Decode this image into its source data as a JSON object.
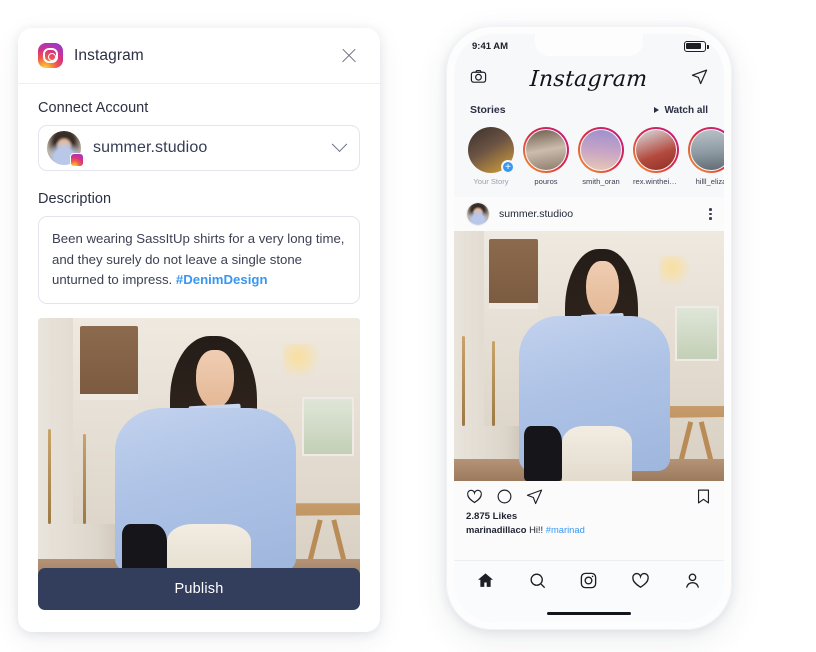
{
  "card": {
    "title": "Instagram",
    "icons": {
      "brand": "instagram-icon",
      "close": "close-icon"
    },
    "connect_label": "Connect Account",
    "account": {
      "username": "summer.studioo",
      "badge": "instagram-badge-icon",
      "chevron": "chevron-down-icon"
    },
    "description_label": "Description",
    "description": {
      "text": "Been wearing SassItUp shirts for a very long time, and they surely do not leave a single stone unturned to impress. ",
      "hashtag": "#DenimDesign"
    },
    "publish_label": "Publish"
  },
  "phone": {
    "status": {
      "time": "9:41 AM",
      "battery": "battery-icon"
    },
    "topbar": {
      "camera": "camera-icon",
      "logo": "Instagram",
      "send": "send-icon"
    },
    "stories_header": {
      "title": "Stories",
      "watch_all": "Watch all"
    },
    "stories": [
      {
        "name": "Your Story",
        "self": true
      },
      {
        "name": "pouros",
        "self": false
      },
      {
        "name": "smith_oran",
        "self": false
      },
      {
        "name": "rex.wintheiser",
        "self": false
      },
      {
        "name": "hilll_eliza",
        "self": false
      }
    ],
    "post": {
      "username": "summer.studioo",
      "menu": "more-options-icon",
      "actions": [
        "like-icon",
        "comment-icon",
        "share-icon",
        "bookmark-icon"
      ],
      "likes": "2.875 Likes",
      "comment_user": "marinadillaco",
      "comment_text": "Hi!!",
      "comment_tag": "#marinad"
    },
    "tabbar": [
      "home-icon",
      "search-icon",
      "reels-icon",
      "activity-icon",
      "profile-icon"
    ]
  },
  "colors": {
    "publish_bg": "#333d5c",
    "link_blue": "#3897f0",
    "text_dark": "#2b3044",
    "border": "#e2e5ec"
  }
}
